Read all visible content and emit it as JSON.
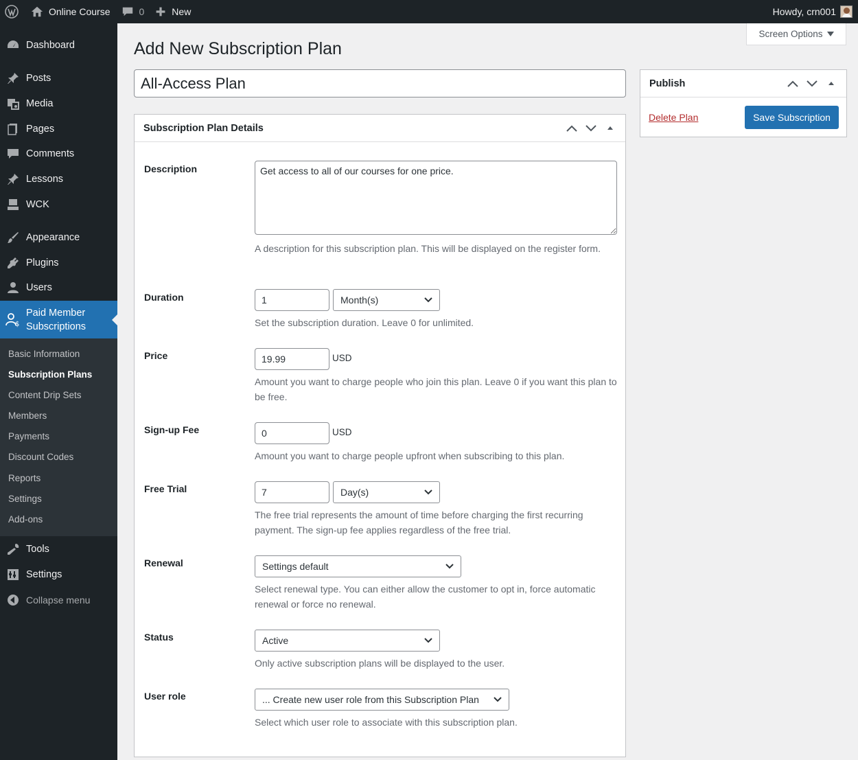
{
  "admin_bar": {
    "site_name": "Online Course",
    "comments_count": "0",
    "new_label": "New",
    "howdy": "Howdy, crn001"
  },
  "sidebar": {
    "items": [
      {
        "label": "Dashboard",
        "icon": "dashboard-icon"
      },
      {
        "label": "Posts",
        "icon": "pin-icon"
      },
      {
        "label": "Media",
        "icon": "media-icon"
      },
      {
        "label": "Pages",
        "icon": "pages-icon"
      },
      {
        "label": "Comments",
        "icon": "comments-icon"
      },
      {
        "label": "Lessons",
        "icon": "pin-icon"
      },
      {
        "label": "WCK",
        "icon": "wck-icon"
      },
      {
        "label": "Appearance",
        "icon": "brush-icon"
      },
      {
        "label": "Plugins",
        "icon": "plugin-icon"
      },
      {
        "label": "Users",
        "icon": "user-icon"
      },
      {
        "label": "Paid Member Subscriptions",
        "label_line1": "Paid Member",
        "label_line2": "Subscriptions",
        "icon": "members-icon"
      },
      {
        "label": "Tools",
        "icon": "wrench-icon"
      },
      {
        "label": "Settings",
        "icon": "settings-icon"
      }
    ],
    "submenu": [
      "Basic Information",
      "Subscription Plans",
      "Content Drip Sets",
      "Members",
      "Payments",
      "Discount Codes",
      "Reports",
      "Settings",
      "Add-ons"
    ],
    "active_submenu": "Subscription Plans",
    "collapse_label": "Collapse menu"
  },
  "screen_options": "Screen Options",
  "page_title": "Add New Subscription Plan",
  "plan_title": "All-Access Plan",
  "details_box": {
    "title": "Subscription Plan Details",
    "description": {
      "label": "Description",
      "value": "Get access to all of our courses for one price.",
      "help": "A description for this subscription plan. This will be displayed on the register form."
    },
    "duration": {
      "label": "Duration",
      "value": "1",
      "unit": "Month(s)",
      "help": "Set the subscription duration. Leave 0 for unlimited."
    },
    "price": {
      "label": "Price",
      "value": "19.99",
      "currency": "USD",
      "help": "Amount you want to charge people who join this plan. Leave 0 if you want this plan to be free."
    },
    "signup_fee": {
      "label": "Sign-up Fee",
      "value": "0",
      "currency": "USD",
      "help": "Amount you want to charge people upfront when subscribing to this plan."
    },
    "free_trial": {
      "label": "Free Trial",
      "value": "7",
      "unit": "Day(s)",
      "help": "The free trial represents the amount of time before charging the first recurring payment. The sign-up fee applies regardless of the free trial."
    },
    "renewal": {
      "label": "Renewal",
      "value": "Settings default",
      "help": "Select renewal type. You can either allow the customer to opt in, force automatic renewal or force no renewal."
    },
    "status": {
      "label": "Status",
      "value": "Active",
      "help": "Only active subscription plans will be displayed to the user."
    },
    "user_role": {
      "label": "User role",
      "value": "... Create new user role from this Subscription Plan",
      "help": "Select which user role to associate with this subscription plan."
    }
  },
  "publish_box": {
    "title": "Publish",
    "delete_label": "Delete Plan",
    "save_label": "Save Subscription"
  },
  "colors": {
    "accent": "#2271b1",
    "sidebar_bg": "#1d2327",
    "delete": "#b32d2e"
  }
}
